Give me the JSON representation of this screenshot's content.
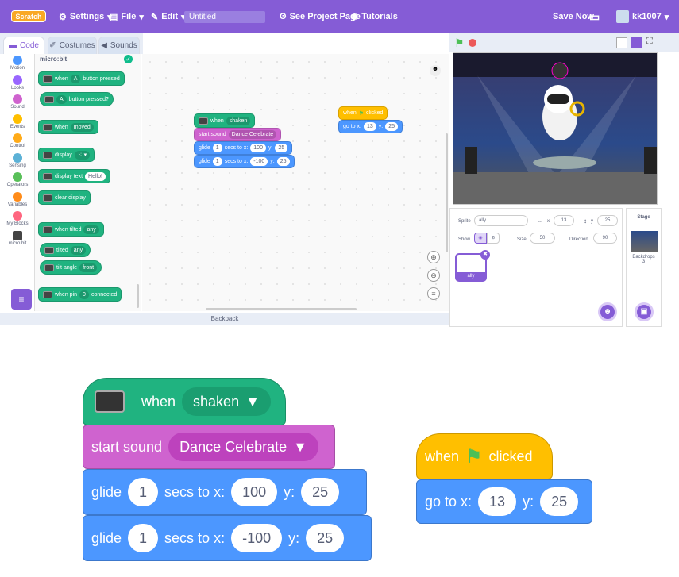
{
  "menubar": {
    "logo": "Scratch",
    "settings": "Settings",
    "file": "File",
    "edit": "Edit",
    "project_title": "Untitled",
    "see_project": "See Project Page",
    "tutorials": "Tutorials",
    "save_now": "Save Now",
    "username": "kk1007"
  },
  "tabs": {
    "code": "Code",
    "costumes": "Costumes",
    "sounds": "Sounds"
  },
  "categories": [
    "Motion",
    "Looks",
    "Sound",
    "Events",
    "Control",
    "Sensing",
    "Operators",
    "Variables",
    "My Blocks",
    "micro:bit"
  ],
  "category_colors": [
    "#4c97ff",
    "#9966ff",
    "#cf63cf",
    "#ffbf00",
    "#ffab19",
    "#5cb1d6",
    "#59c059",
    "#ff8c1a",
    "#ff6680",
    "#444444"
  ],
  "palette": {
    "header": "micro:bit",
    "b1": {
      "when": "when",
      "btn": "A",
      "tail": "button pressed"
    },
    "b2": {
      "btn": "A",
      "tail": "button pressed?"
    },
    "b3": {
      "when": "when",
      "opt": "moved"
    },
    "b4": {
      "label": "display"
    },
    "b5": {
      "label": "display text",
      "value": "Hello!"
    },
    "b6": {
      "label": "clear display"
    },
    "b7": {
      "when": "when tilted",
      "opt": "any"
    },
    "b8": {
      "label": "tilted",
      "opt": "any"
    },
    "b9": {
      "label": "tilt angle",
      "opt": "front"
    },
    "b10": {
      "label": "when pin",
      "opt": "0",
      "tail": "connected"
    }
  },
  "script1": {
    "hat_when": "when",
    "hat_opt": "shaken",
    "sound_label": "start sound",
    "sound_opt": "Dance Celebrate",
    "glide": "glide",
    "secs": "1",
    "secs_to_x": "secs to x:",
    "x1": "100",
    "y_label": "y:",
    "y1": "25",
    "x2": "-100",
    "y2": "25"
  },
  "script2": {
    "when": "when",
    "clicked": "clicked",
    "goto": "go to x:",
    "x": "13",
    "y_label": "y:",
    "y": "25"
  },
  "sprite": {
    "label": "Sprite",
    "name": "ally",
    "x_label": "x",
    "x": "13",
    "y_label": "y",
    "y": "25",
    "show": "Show",
    "size_label": "Size",
    "size": "50",
    "dir_label": "Direction",
    "dir": "90",
    "thumb": "ally"
  },
  "stage_panel": {
    "title": "Stage",
    "backdrops": "Backdrops",
    "count": "3"
  },
  "backpack": "Backpack"
}
